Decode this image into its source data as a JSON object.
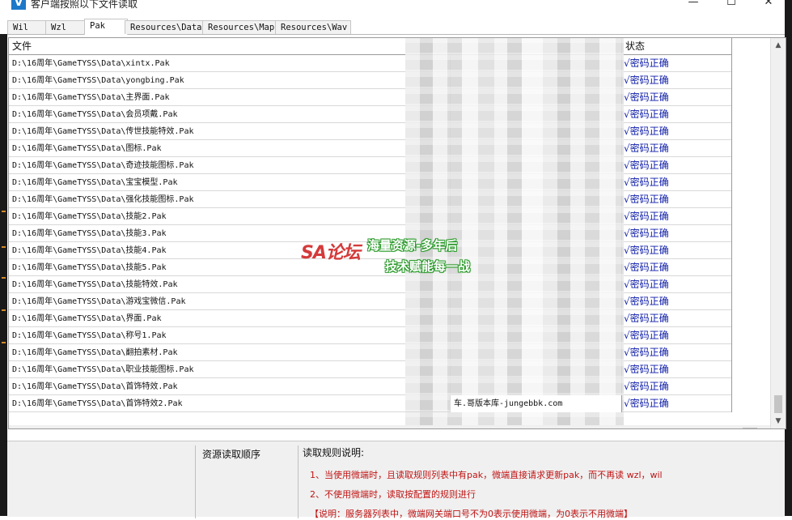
{
  "window": {
    "icon_letter": "V",
    "title": "客户端按照以下文件读取",
    "minimize": "—",
    "maximize": "☐",
    "close": "✕"
  },
  "tabs": [
    {
      "label": "Wil",
      "active": false
    },
    {
      "label": "Wzl",
      "active": false
    },
    {
      "label": "Pak",
      "active": true
    },
    {
      "label": "Resources\\Data",
      "active": false
    },
    {
      "label": "Resources\\Map",
      "active": false
    },
    {
      "label": "Resources\\Wav",
      "active": false
    }
  ],
  "table": {
    "columns": {
      "file": "文件",
      "status": "状态"
    },
    "rows": [
      {
        "file": "D:\\16周年\\GameTYSS\\Data\\xintx.Pak",
        "extra": "",
        "status": "√密码正确"
      },
      {
        "file": "D:\\16周年\\GameTYSS\\Data\\yongbing.Pak",
        "extra": "",
        "status": "√密码正确"
      },
      {
        "file": "D:\\16周年\\GameTYSS\\Data\\主界面.Pak",
        "extra": "",
        "status": "√密码正确"
      },
      {
        "file": "D:\\16周年\\GameTYSS\\Data\\会员项戴.Pak",
        "extra": "",
        "status": "√密码正确"
      },
      {
        "file": "D:\\16周年\\GameTYSS\\Data\\传世技能特效.Pak",
        "extra": "",
        "status": "√密码正确"
      },
      {
        "file": "D:\\16周年\\GameTYSS\\Data\\图标.Pak",
        "extra": "",
        "status": "√密码正确"
      },
      {
        "file": "D:\\16周年\\GameTYSS\\Data\\奇迹技能图标.Pak",
        "extra": "",
        "status": "√密码正确"
      },
      {
        "file": "D:\\16周年\\GameTYSS\\Data\\宝宝模型.Pak",
        "extra": "",
        "status": "√密码正确"
      },
      {
        "file": "D:\\16周年\\GameTYSS\\Data\\强化技能图标.Pak",
        "extra": "",
        "status": "√密码正确"
      },
      {
        "file": "D:\\16周年\\GameTYSS\\Data\\技能2.Pak",
        "extra": "",
        "status": "√密码正确"
      },
      {
        "file": "D:\\16周年\\GameTYSS\\Data\\技能3.Pak",
        "extra": "",
        "status": "√密码正确"
      },
      {
        "file": "D:\\16周年\\GameTYSS\\Data\\技能4.Pak",
        "extra": "",
        "status": "√密码正确"
      },
      {
        "file": "D:\\16周年\\GameTYSS\\Data\\技能5.Pak",
        "extra": "",
        "status": "√密码正确"
      },
      {
        "file": "D:\\16周年\\GameTYSS\\Data\\技能特效.Pak",
        "extra": "",
        "status": "√密码正确"
      },
      {
        "file": "D:\\16周年\\GameTYSS\\Data\\游戏宝微信.Pak",
        "extra": "",
        "status": "√密码正确"
      },
      {
        "file": "D:\\16周年\\GameTYSS\\Data\\界面.Pak",
        "extra": "",
        "status": "√密码正确"
      },
      {
        "file": "D:\\16周年\\GameTYSS\\Data\\称号1.Pak",
        "extra": "",
        "status": "√密码正确"
      },
      {
        "file": "D:\\16周年\\GameTYSS\\Data\\翻拍素材.Pak",
        "extra": "",
        "status": "√密码正确"
      },
      {
        "file": "D:\\16周年\\GameTYSS\\Data\\职业技能图标.Pak",
        "extra": "",
        "status": "√密码正确"
      },
      {
        "file": "D:\\16周年\\GameTYSS\\Data\\首饰特效.Pak",
        "extra": "",
        "status": "√密码正确"
      },
      {
        "file": "D:\\16周年\\GameTYSS\\Data\\首饰特效2.Pak",
        "extra": "车.哥版本库-jungebbk.com",
        "status": "√密码正确"
      }
    ]
  },
  "scroll": {
    "up": "▲",
    "down": "▼",
    "left": "<",
    "right": ">"
  },
  "bottom": {
    "order_label": "资源读取顺序",
    "rules_title": "读取规则说明:",
    "rules": [
      "1、当使用微端时，且读取规则列表中有pak，微端直接请求更新pak，而不再读 wzl，wil",
      "2、不使用微端时，读取按配置的规则进行",
      "【说明：服务器列表中，微端网关端口号不为0表示使用微端，为0表示不用微端】"
    ]
  },
  "watermark": {
    "logo_latin": "SA",
    "logo_cn": "论坛",
    "line1": "海量资源-多年后",
    "line2": "技术赋能每一战"
  }
}
